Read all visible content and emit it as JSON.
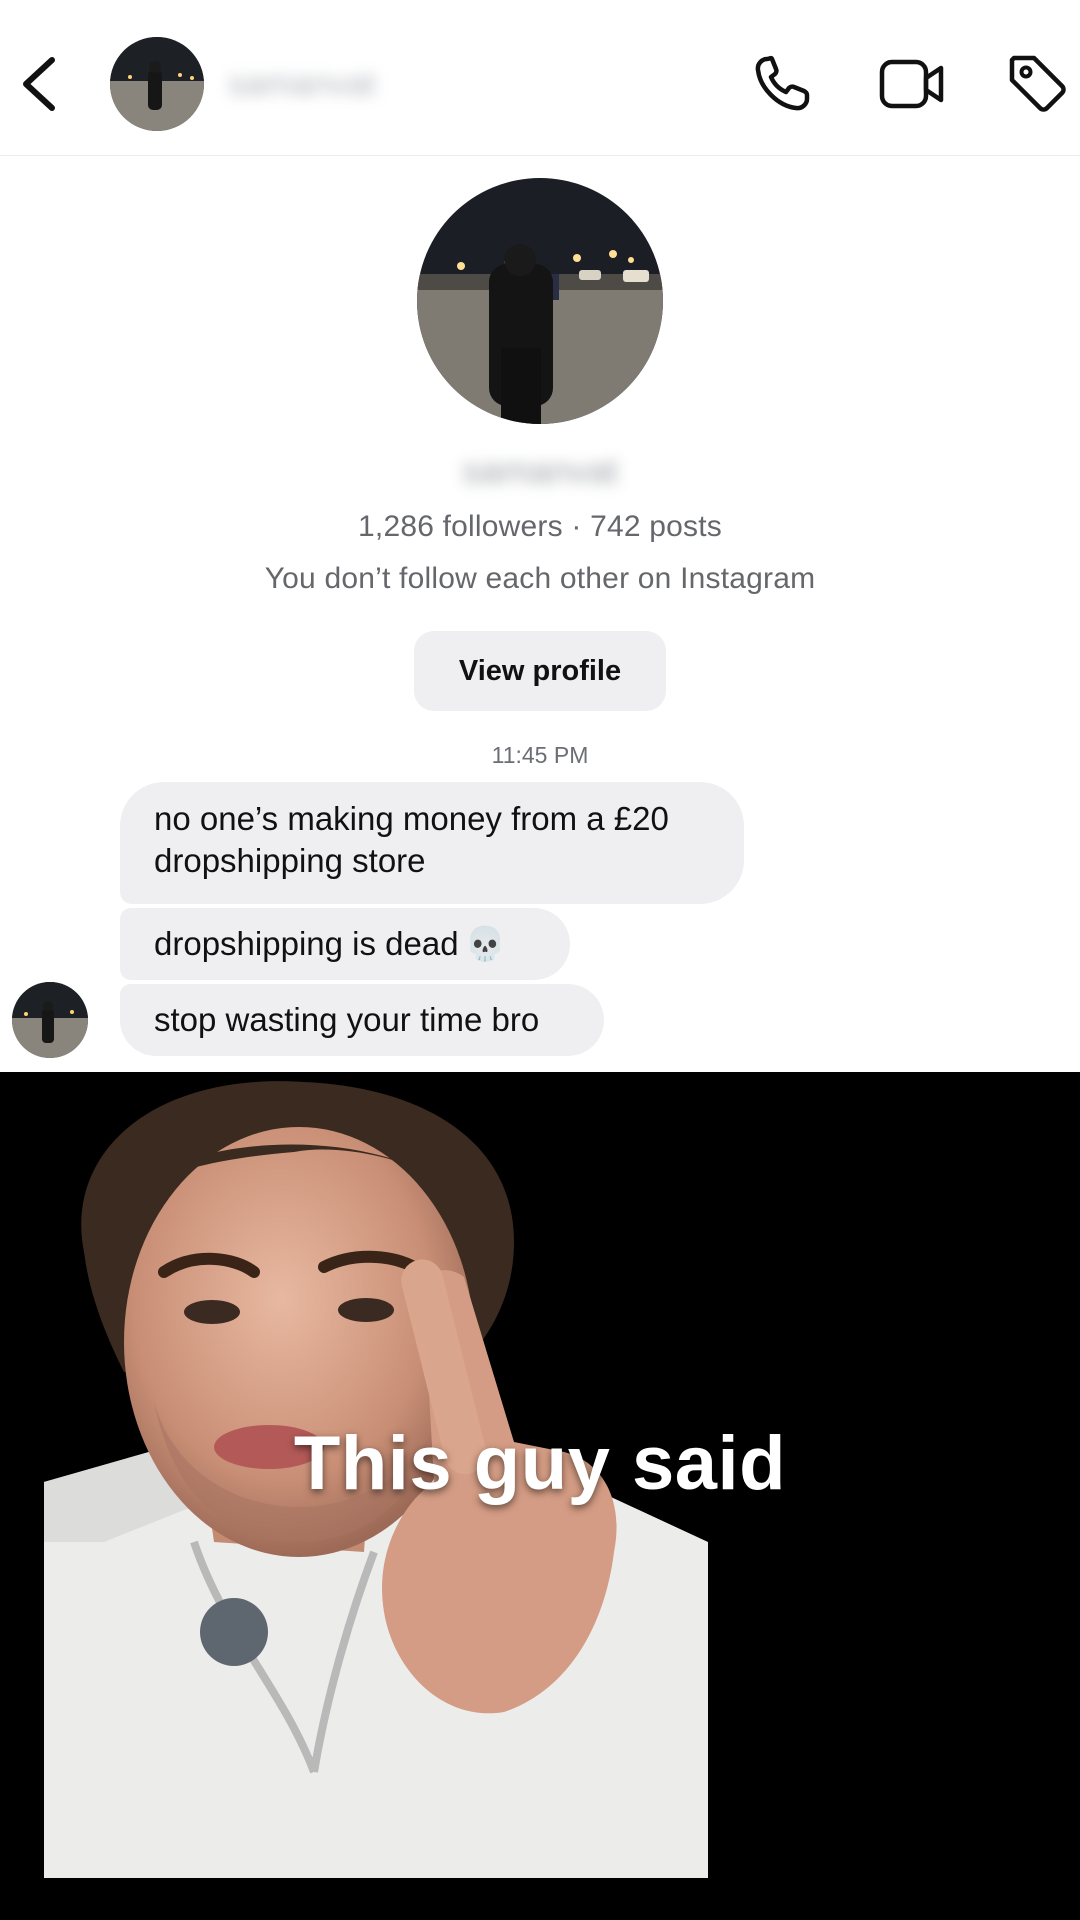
{
  "header": {
    "username_blurred": "samanvat",
    "back_icon": "chevron-left-icon",
    "call_icon": "phone-icon",
    "video_icon": "video-camera-icon",
    "tag_icon": "tag-icon"
  },
  "profile": {
    "name_blurred": "samanvat",
    "stats": "1,286 followers · 742 posts",
    "relation": "You don’t follow each other on Instagram",
    "view_profile_label": "View profile"
  },
  "conversation": {
    "timestamp": "11:45 PM",
    "messages": [
      {
        "text": "no one’s making money from a £20 dropshipping store"
      },
      {
        "text": "dropshipping is dead",
        "emoji": "💀"
      },
      {
        "text": "stop wasting your time bro"
      }
    ]
  },
  "video": {
    "caption": "This guy said"
  }
}
